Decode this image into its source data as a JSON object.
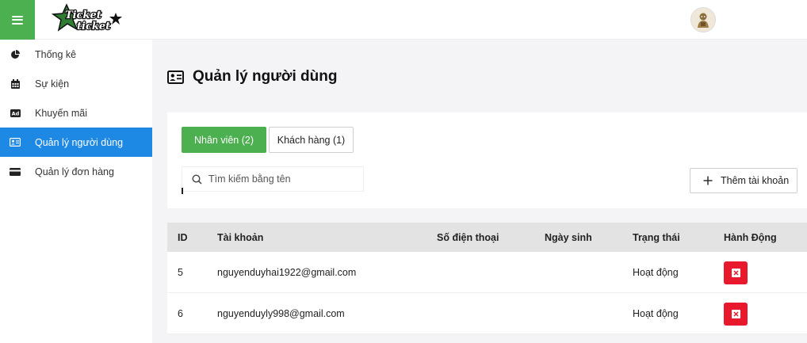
{
  "header": {
    "logo_text_line1": "Ticket",
    "logo_text_line2": "ticket",
    "menu_icon": "hamburger-icon",
    "avatar_icon": "user-avatar"
  },
  "sidebar": {
    "items": [
      {
        "label": "Thống kê",
        "icon": "pie-chart-icon"
      },
      {
        "label": "Sự kiện",
        "icon": "calendar-icon"
      },
      {
        "label": "Khuyến mãi",
        "icon": "ad-icon"
      },
      {
        "label": "Quản lý người dùng",
        "icon": "id-card-icon",
        "active": true
      },
      {
        "label": "Quản lý đơn hàng",
        "icon": "credit-card-icon"
      }
    ]
  },
  "main": {
    "title": "Quản lý người dùng",
    "title_icon": "id-card-icon",
    "tabs": [
      {
        "label": "Nhân viên (2)",
        "active": true
      },
      {
        "label": "Khách hàng (1)",
        "active": false
      }
    ],
    "search": {
      "placeholder": "Tìm kiếm bằng tên",
      "value": ""
    },
    "add_button_label": "Thêm tài khoản"
  },
  "table": {
    "columns": [
      "ID",
      "Tài khoản",
      "Số điện thoại",
      "Ngày sinh",
      "Trạng thái",
      "Hành Động"
    ],
    "rows": [
      {
        "id": "5",
        "account": "nguyenduyhai1922@gmail.com",
        "phone": "",
        "dob": "",
        "status": "Hoạt động"
      },
      {
        "id": "6",
        "account": "nguyenduyly998@gmail.com",
        "phone": "",
        "dob": "",
        "status": "Hoạt động"
      }
    ]
  },
  "colors": {
    "primary_green": "#4caf50",
    "active_blue": "#1e88e5",
    "danger_red": "#e8192c"
  }
}
